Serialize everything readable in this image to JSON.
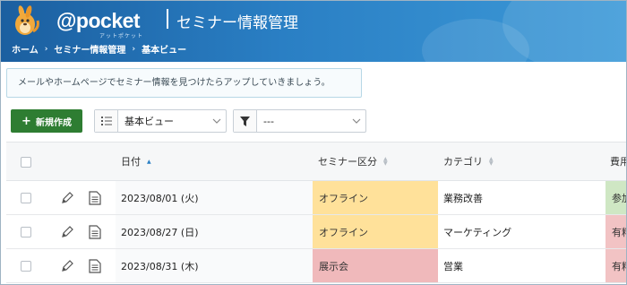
{
  "header": {
    "brand": "@pocket",
    "brand_sub": "アットポケット",
    "title": "セミナー情報管理",
    "breadcrumb": [
      "ホーム",
      "セミナー情報管理",
      "基本ビュー"
    ]
  },
  "info_message": "メールやホームページでセミナー情報を見つけたらアップしていきましょう。",
  "toolbar": {
    "new_button": "新規作成",
    "view_select": "基本ビュー",
    "filter_select": "---"
  },
  "table": {
    "columns": [
      "日付",
      "セミナー区分",
      "カテゴリ",
      "費用"
    ],
    "rows": [
      {
        "date": "2023/08/01 (火)",
        "kubun": "オフライン",
        "category": "業務改善",
        "cost": "参加"
      },
      {
        "date": "2023/08/27 (日)",
        "kubun": "オフライン",
        "category": "マーケティング",
        "cost": "有料"
      },
      {
        "date": "2023/08/31 (木)",
        "kubun": "展示会",
        "category": "営業",
        "cost": "有料"
      }
    ]
  },
  "colors": {
    "header_blue": "#1b5fa0",
    "new_button_green": "#2e7d32",
    "offline_yellow": "#ffe19a",
    "exhibition_pink": "#f0b9bb",
    "cost_green": "#cfe7c4",
    "cost_pink": "#f2c3c4"
  },
  "icons": {
    "edit": "pencil-icon",
    "detail": "document-icon",
    "list": "list-icon",
    "filter": "filter-icon"
  }
}
